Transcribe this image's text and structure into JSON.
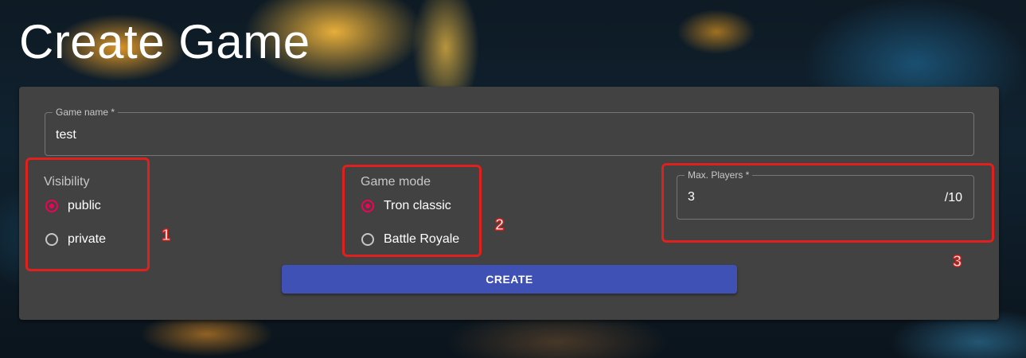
{
  "page": {
    "title": "Create Game"
  },
  "form": {
    "game_name": {
      "label": "Game name *",
      "value": "test"
    },
    "visibility": {
      "label": "Visibility",
      "options": [
        {
          "label": "public",
          "checked": true
        },
        {
          "label": "private",
          "checked": false
        }
      ]
    },
    "game_mode": {
      "label": "Game mode",
      "options": [
        {
          "label": "Tron classic",
          "checked": true
        },
        {
          "label": "Battle Royale",
          "checked": false
        }
      ]
    },
    "max_players": {
      "label": "Max. Players *",
      "value": "3",
      "suffix": "/10"
    },
    "create_label": "CREATE"
  },
  "annotations": [
    "1",
    "2",
    "3"
  ],
  "colors": {
    "accent_radio": "#f50057",
    "primary_button": "#3f51b5",
    "card": "#424242",
    "annotation": "#e0201c"
  }
}
